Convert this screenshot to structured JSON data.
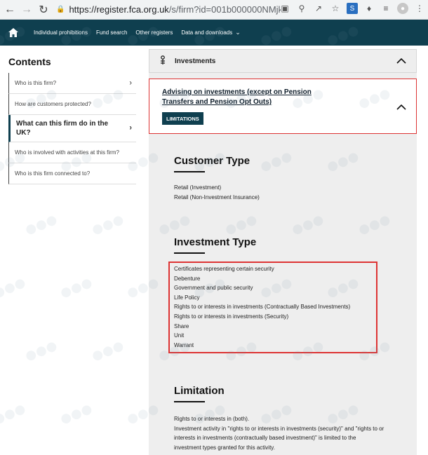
{
  "browser": {
    "url_host": "https://register.fca.org.uk",
    "url_rest": "/s/firm?id=001b000000NMjk..."
  },
  "nav": {
    "items": [
      "Individual prohibitions",
      "Fund search",
      "Other registers",
      "Data and downloads"
    ]
  },
  "sidebar": {
    "title": "Contents",
    "items": [
      {
        "label": "Who is this firm?"
      },
      {
        "label": "How are customers protected?"
      },
      {
        "label": "What can this firm do in the UK?"
      },
      {
        "label": "Who is involved with activities at this firm?"
      },
      {
        "label": "Who is this firm connected to?"
      }
    ]
  },
  "main": {
    "accordion_title": "Investments",
    "activity_title": "Advising on investments (except on Pension Transfers and Pension Opt Outs)",
    "limitations_button": "LIMITATIONS",
    "customer_type": {
      "heading": "Customer Type",
      "items": [
        "Retail (Investment)",
        "Retail (Non-Investment Insurance)"
      ]
    },
    "investment_type": {
      "heading": "Investment Type",
      "items": [
        "Certificates representing certain security",
        "Debenture",
        "Government and public security",
        "Life Policy",
        "Rights to or interests in investments (Contractually Based Investments)",
        "Rights to or interests in investments (Security)",
        "Share",
        "Unit",
        "Warrant"
      ]
    },
    "limitation": {
      "heading": "Limitation",
      "line1": "Rights to or interests in (both).",
      "line2": "Investment activity in \"rights to or interests in investments (security)\" and \"rights to or interests in investments (contractually based investment)\" is limited to the investment types granted for this activity."
    }
  },
  "colors": {
    "nav_bg": "#0f3f4f",
    "highlight": "#dd3333",
    "panel_bg": "#eeeeee"
  }
}
